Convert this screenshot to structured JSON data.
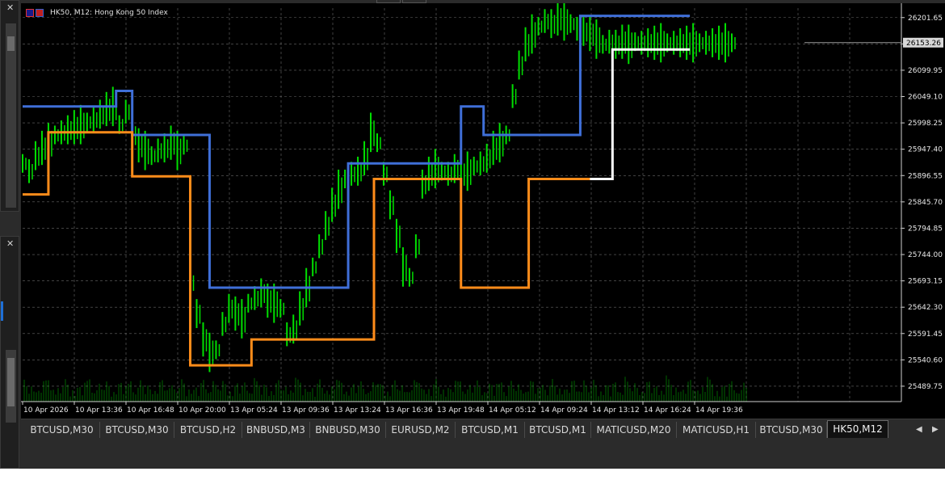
{
  "window": {
    "chart_title": "HK50, M12:  Hong Kong 50 Index",
    "current_price": "26153.26"
  },
  "tabs": [
    {
      "label": "BTCUSD,M30"
    },
    {
      "label": "BTCUSD,M30"
    },
    {
      "label": "BTCUSD,H2"
    },
    {
      "label": "BNBUSD,M3"
    },
    {
      "label": "BNBUSD,M30"
    },
    {
      "label": "EURUSD,M2"
    },
    {
      "label": "BTCUSD,M1"
    },
    {
      "label": "BTCUSD,M1"
    },
    {
      "label": "MATICUSD,M20"
    },
    {
      "label": "MATICUSD,H1"
    },
    {
      "label": "BTCUSD,M30"
    },
    {
      "label": "HK50,M12"
    }
  ],
  "active_tab_index": 11,
  "icons": {
    "tab_scroll_left": "left-arrow-icon",
    "tab_scroll_right": "right-arrow-icon",
    "dock_close": "close-icon"
  },
  "colors": {
    "background": "#000000",
    "grid": "#c0c0c0",
    "candles": "#00e000",
    "upper_channel": "#3f6fd8",
    "lower_channel": "#ff8c1a",
    "highlight_channel": "#ffffff",
    "volume": "#00e000",
    "axis_text": "#e8e8e8"
  },
  "chart_data": {
    "type": "line",
    "title": "HK50, M12:  Hong Kong 50 Index",
    "y_ticks": [
      "26201.65",
      "26150.80",
      "26099.95",
      "26049.10",
      "25998.25",
      "25947.40",
      "25896.55",
      "25845.70",
      "25794.85",
      "25744.00",
      "25693.15",
      "25642.30",
      "25591.45",
      "25540.60",
      "25489.75"
    ],
    "x_ticks": [
      "10 Apr 2026",
      "10 Apr 13:36",
      "10 Apr 16:48",
      "10 Apr 20:00",
      "13 Apr 05:24",
      "13 Apr 09:36",
      "13 Apr 13:24",
      "13 Apr 16:36",
      "13 Apr 19:48",
      "14 Apr 05:12",
      "14 Apr 09:24",
      "14 Apr 13:12",
      "14 Apr 16:24",
      "14 Apr 19:36"
    ],
    "ylim": [
      25460,
      26220
    ],
    "price_x": [
      0,
      2,
      4,
      6,
      8,
      10,
      12,
      14,
      16,
      18,
      20,
      22,
      24,
      26,
      28,
      30,
      32,
      34,
      36,
      38,
      40,
      42,
      44,
      46,
      48,
      50,
      52,
      54,
      56,
      58,
      60,
      62,
      64,
      66,
      68,
      70,
      72,
      74,
      76,
      78,
      80,
      82,
      84,
      86,
      88,
      90,
      92,
      94,
      96,
      98,
      100,
      102,
      104,
      106,
      108,
      110,
      112,
      114,
      116,
      118,
      120,
      122,
      124,
      126,
      128,
      130,
      132,
      134,
      136,
      138,
      140,
      142,
      144,
      146,
      148,
      150,
      152,
      154,
      156,
      158,
      160,
      162,
      164,
      166,
      168,
      170,
      172,
      174,
      176,
      178,
      180,
      182,
      184,
      186,
      188,
      190,
      192,
      194,
      196,
      198,
      200,
      202,
      204,
      206,
      208,
      210,
      212,
      214,
      216,
      218,
      220
    ],
    "price_y": [
      25920,
      25905,
      25935,
      25950,
      25960,
      25975,
      25980,
      25985,
      25990,
      25995,
      26000,
      26005,
      26015,
      26025,
      26030,
      25995,
      26020,
      25975,
      25955,
      25945,
      25935,
      25945,
      25950,
      25960,
      25945,
      25955,
      25690,
      25630,
      25580,
      25555,
      25560,
      25610,
      25640,
      25630,
      25620,
      25650,
      25660,
      25670,
      25655,
      25650,
      25640,
      25590,
      25600,
      25640,
      25680,
      25720,
      25760,
      25800,
      25840,
      25870,
      25890,
      25900,
      25905,
      25930,
      25980,
      25960,
      25900,
      25840,
      25780,
      25720,
      25700,
      25760,
      25880,
      25900,
      25910,
      25905,
      25900,
      25910,
      25900,
      25905,
      25915,
      25920,
      25930,
      25950,
      25960,
      25975,
      26050,
      26110,
      26150,
      26170,
      26185,
      26195,
      26190,
      26200,
      26195,
      26190,
      26180,
      26175,
      26170,
      26160,
      26150,
      26155,
      26150,
      26155,
      26150,
      26155,
      26153,
      26153,
      26153,
      26153,
      26153,
      26153,
      26153,
      26153,
      26153,
      26153,
      26153,
      26153,
      26153,
      26153,
      26153
    ],
    "series": [
      {
        "name": "",
        "steps": [
          [
            0,
            26030
          ],
          [
            29,
            26030
          ],
          [
            29,
            26060
          ],
          [
            34,
            26060
          ],
          [
            34,
            25975
          ],
          [
            58,
            25975
          ],
          [
            58,
            25680
          ],
          [
            101,
            25680
          ],
          [
            101,
            25920
          ],
          [
            136,
            25920
          ],
          [
            136,
            26030
          ],
          [
            143,
            26030
          ],
          [
            143,
            25975
          ],
          [
            173,
            25975
          ],
          [
            173,
            26205
          ],
          [
            207,
            26205
          ]
        ]
      },
      {
        "name": "",
        "steps": [
          [
            0,
            25860
          ],
          [
            8,
            25860
          ],
          [
            8,
            25980
          ],
          [
            34,
            25980
          ],
          [
            34,
            25895
          ],
          [
            52,
            25895
          ],
          [
            52,
            25530
          ],
          [
            71,
            25530
          ],
          [
            71,
            25580
          ],
          [
            109,
            25580
          ],
          [
            109,
            25890
          ],
          [
            136,
            25890
          ],
          [
            136,
            25680
          ],
          [
            157,
            25680
          ],
          [
            157,
            25890
          ],
          [
            183,
            25890
          ]
        ]
      },
      {
        "name": "",
        "steps": [
          [
            176,
            25890
          ],
          [
            183,
            25890
          ],
          [
            183,
            26140
          ],
          [
            207,
            26140
          ]
        ]
      }
    ]
  }
}
